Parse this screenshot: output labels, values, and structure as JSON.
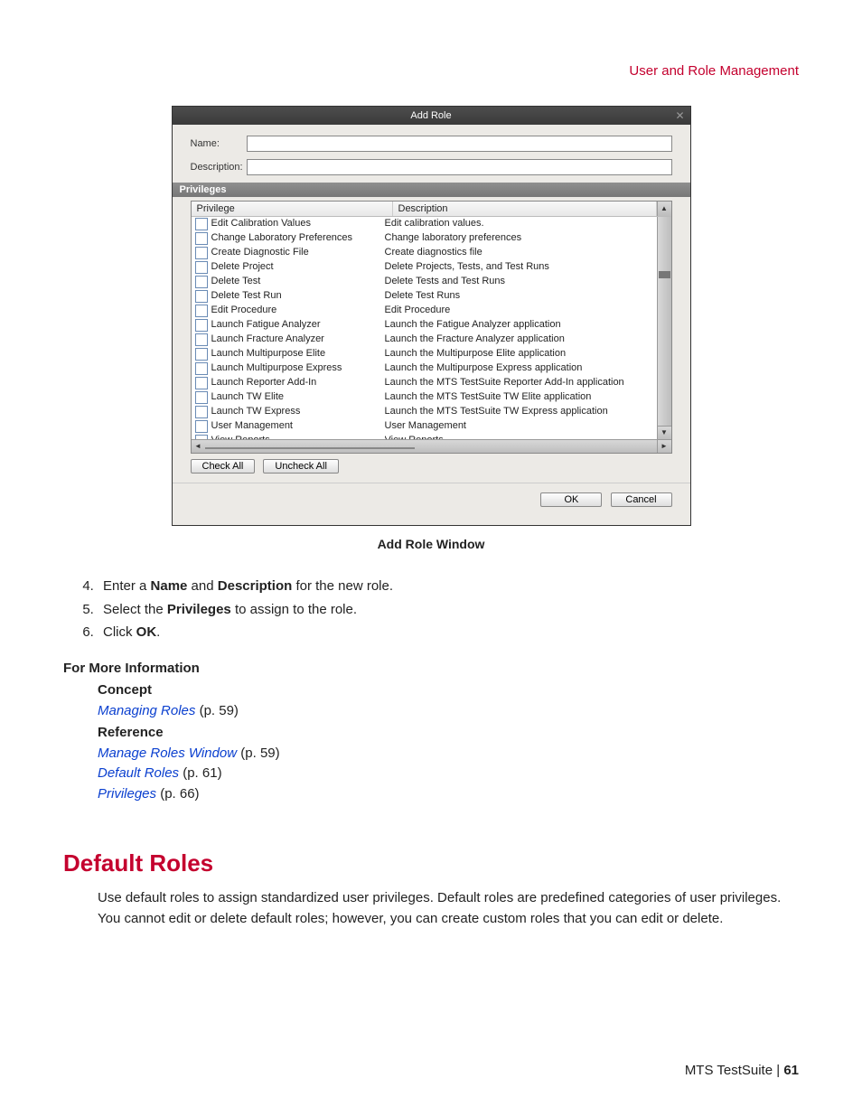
{
  "header": {
    "section": "User and Role Management"
  },
  "dialog": {
    "title": "Add Role",
    "name_label": "Name:",
    "desc_label": "Description:",
    "privileges_title": "Privileges",
    "col_privilege": "Privilege",
    "col_description": "Description",
    "rows": [
      {
        "priv": "Edit Calibration Values",
        "desc": "Edit calibration values."
      },
      {
        "priv": "Change Laboratory Preferences",
        "desc": "Change laboratory preferences"
      },
      {
        "priv": "Create Diagnostic File",
        "desc": "Create diagnostics file"
      },
      {
        "priv": "Delete Project",
        "desc": "Delete Projects, Tests, and Test Runs"
      },
      {
        "priv": "Delete Test",
        "desc": "Delete Tests and Test Runs"
      },
      {
        "priv": "Delete Test Run",
        "desc": "Delete Test Runs"
      },
      {
        "priv": "Edit Procedure",
        "desc": "Edit Procedure"
      },
      {
        "priv": "Launch Fatigue Analyzer",
        "desc": "Launch the Fatigue Analyzer application"
      },
      {
        "priv": "Launch Fracture Analyzer",
        "desc": "Launch the Fracture Analyzer application"
      },
      {
        "priv": "Launch Multipurpose Elite",
        "desc": "Launch the Multipurpose Elite application"
      },
      {
        "priv": "Launch Multipurpose Express",
        "desc": "Launch the Multipurpose Express application"
      },
      {
        "priv": "Launch Reporter Add-In",
        "desc": "Launch the MTS TestSuite Reporter Add-In application"
      },
      {
        "priv": "Launch TW Elite",
        "desc": "Launch the MTS TestSuite TW Elite application"
      },
      {
        "priv": "Launch TW Express",
        "desc": "Launch the MTS TestSuite TW Express application"
      },
      {
        "priv": "User Management",
        "desc": "User Management"
      },
      {
        "priv": "View Reports",
        "desc": "View Reports"
      }
    ],
    "check_all": "Check All",
    "uncheck_all": "Uncheck All",
    "ok": "OK",
    "cancel": "Cancel"
  },
  "caption": "Add Role Window",
  "steps": {
    "s4a": "Enter a ",
    "s4b": "Name",
    "s4c": " and ",
    "s4d": "Description",
    "s4e": " for the new role.",
    "s5a": "Select the ",
    "s5b": "Privileges",
    "s5c": " to assign to the role.",
    "s6a": "Click ",
    "s6b": "OK",
    "s6c": "."
  },
  "fmi": {
    "title": "For More Information",
    "concept": "Concept",
    "l1": "Managing Roles",
    "l1p": "  (p. 59)",
    "reference": "Reference",
    "l2": "Manage Roles Window",
    "l2p": "  (p. 59)",
    "l3": "Default Roles",
    "l3p": "  (p. 61)",
    "l4": "Privileges",
    "l4p": "  (p. 66)"
  },
  "section_heading": "Default Roles",
  "section_para": "Use default roles to assign standardized user privileges. Default roles are predefined categories of user privileges. You cannot edit or delete default roles; however, you can create custom roles that you can edit or delete.",
  "footer": {
    "product": "MTS TestSuite | ",
    "page": "61"
  }
}
